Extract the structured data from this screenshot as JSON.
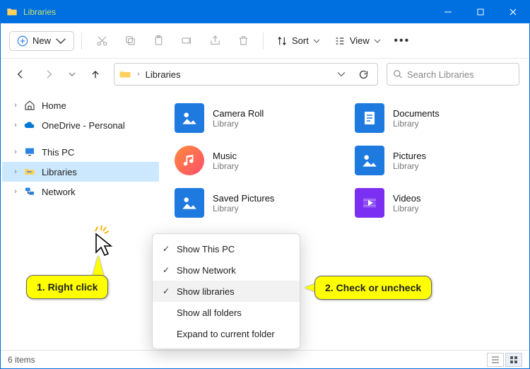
{
  "window": {
    "title": "Libraries"
  },
  "toolbar": {
    "new_label": "New",
    "sort_label": "Sort",
    "view_label": "View"
  },
  "nav": {
    "address": "Libraries",
    "search_placeholder": "Search Libraries"
  },
  "sidebar": {
    "items": [
      {
        "label": "Home"
      },
      {
        "label": "OneDrive - Personal"
      },
      {
        "label": "This PC"
      },
      {
        "label": "Libraries"
      },
      {
        "label": "Network"
      }
    ]
  },
  "libraries": [
    {
      "name": "Camera Roll",
      "sub": "Library"
    },
    {
      "name": "Documents",
      "sub": "Library"
    },
    {
      "name": "Music",
      "sub": "Library"
    },
    {
      "name": "Pictures",
      "sub": "Library"
    },
    {
      "name": "Saved Pictures",
      "sub": "Library"
    },
    {
      "name": "Videos",
      "sub": "Library"
    }
  ],
  "context_menu": {
    "items": [
      {
        "label": "Show This PC",
        "checked": true
      },
      {
        "label": "Show Network",
        "checked": true
      },
      {
        "label": "Show libraries",
        "checked": true,
        "highlight": true
      },
      {
        "label": "Show all folders",
        "checked": false
      },
      {
        "label": "Expand to current folder",
        "checked": false
      }
    ]
  },
  "status": {
    "count_text": "6 items"
  },
  "annotations": {
    "step1": "1. Right click",
    "step2": "2. Check or uncheck"
  }
}
